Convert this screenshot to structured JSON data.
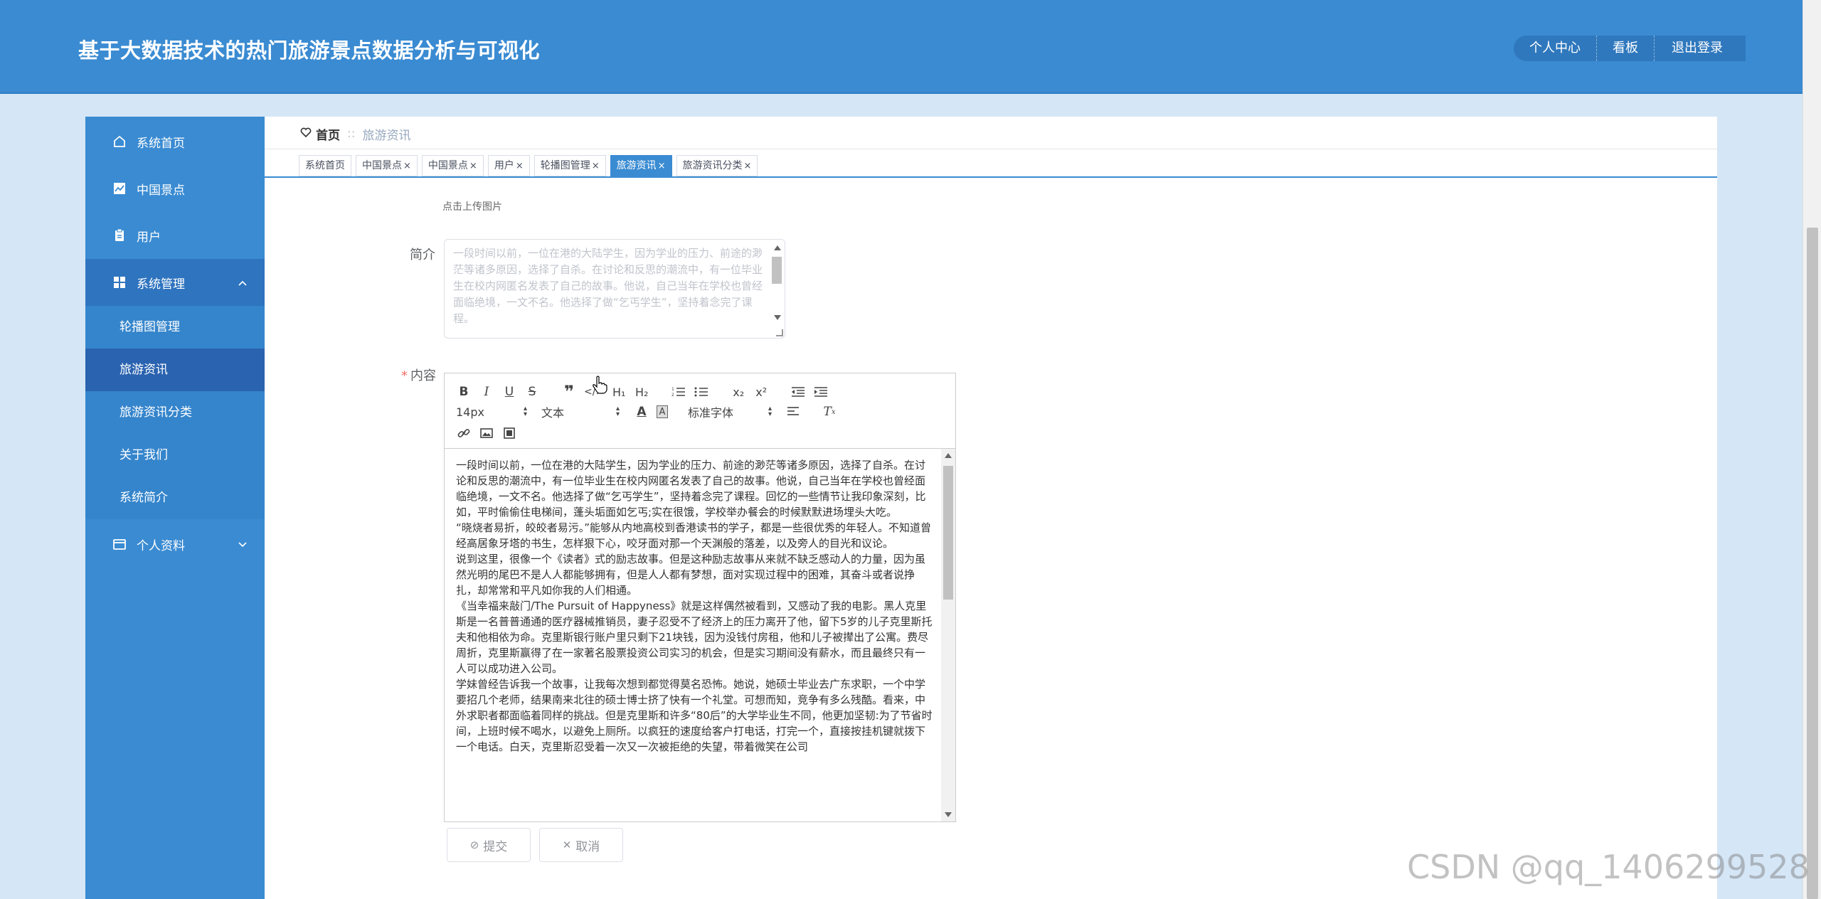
{
  "header": {
    "title": "基于大数据技术的热门旅游景点数据分析与可视化",
    "nav": [
      "个人中心",
      "看板",
      "退出登录"
    ]
  },
  "sidebar": {
    "items": [
      {
        "label": "系统首页",
        "icon": "home-icon"
      },
      {
        "label": "中国景点",
        "icon": "chart-icon"
      },
      {
        "label": "用户",
        "icon": "clipboard-icon"
      },
      {
        "label": "系统管理",
        "icon": "grid-icon"
      },
      {
        "label": "个人资料",
        "icon": "card-icon"
      }
    ],
    "sub_items": [
      "轮播图管理",
      "旅游资讯",
      "旅游资讯分类",
      "关于我们",
      "系统简介"
    ]
  },
  "breadcrumb": {
    "home": "首页",
    "separator": "::",
    "current": "旅游资讯"
  },
  "tabs": [
    {
      "label": "系统首页",
      "closable": false
    },
    {
      "label": "中国景点",
      "closable": true
    },
    {
      "label": "中国景点",
      "closable": true
    },
    {
      "label": "用户",
      "closable": true
    },
    {
      "label": "轮播图管理",
      "closable": true
    },
    {
      "label": "旅游资讯",
      "closable": true,
      "active": true
    },
    {
      "label": "旅游资讯分类",
      "closable": true
    }
  ],
  "form": {
    "upload_tip": "点击上传图片",
    "intro_label": "简介",
    "intro_text": "一段时间以前，一位在港的大陆学生，因为学业的压力、前途的渺茫等诸多原因，选择了自杀。在讨论和反思的潮流中，有一位毕业生在校内网匿名发表了自己的故事。他说，自己当年在学校也曾经面临绝境，一文不名。他选择了做“乞丐学生”，坚持着念完了课程。",
    "content_label": "内容",
    "toolbar": {
      "size": "14px",
      "header": "文本",
      "font": "标准字体"
    },
    "content_paragraphs": [
      "一段时间以前，一位在港的大陆学生，因为学业的压力、前途的渺茫等诸多原因，选择了自杀。在讨论和反思的潮流中，有一位毕业生在校内网匿名发表了自己的故事。他说，自己当年在学校也曾经面临绝境，一文不名。他选择了做“乞丐学生”，坚持着念完了课程。回忆的一些情节让我印象深刻，比如，平时偷偷住电梯间，蓬头垢面如乞丐;实在很饿，学校举办餐会的时候默默进场埋头大吃。",
      "“晓烧者易折，皎皎者易污。”能够从内地高校到香港读书的学子，都是一些很优秀的年轻人。不知道曾经高居象牙塔的书生，怎样狠下心，咬牙面对那一个天渊般的落差，以及旁人的目光和议论。",
      "说到这里，很像一个《读者》式的励志故事。但是这种励志故事从来就不缺乏感动人的力量，因为虽然光明的尾巴不是人人都能够拥有，但是人人都有梦想，面对实现过程中的困难，其奋斗或者说挣扎，却常常和平凡如你我的人们相通。",
      "《当幸福来敲门/The Pursuit of Happyness》就是这样偶然被看到，又感动了我的电影。黑人克里斯是一名普普通通的医疗器械推销员，妻子忍受不了经济上的压力离开了他，留下5岁的儿子克里斯托夫和他相依为命。克里斯银行账户里只剩下21块钱，因为没钱付房租，他和儿子被撵出了公寓。费尽周折，克里斯赢得了在一家著名股票投资公司实习的机会，但是实习期间没有薪水，而且最终只有一人可以成功进入公司。",
      "学妹曾经告诉我一个故事，让我每次想到都觉得莫名恐怖。她说，她硕士毕业去广东求职，一个中学要招几个老师，结果南来北往的硕士博士挤了快有一个礼堂。可想而知，竞争有多么残酷。看来，中外求职者都面临着同样的挑战。但是克里斯和许多“80后”的大学毕业生不同，他更加坚韧:为了节省时间，上班时候不喝水，以避免上厕所。以疯狂的速度给客户打电话，打完一个，直接按挂机键就拨下一个电话。白天，克里斯忍受着一次又一次被拒绝的失望，带着微笑在公司"
    ],
    "submit_label": "提交",
    "cancel_label": "取消"
  },
  "watermark": "CSDN @qq_1406299528",
  "colors": {
    "header_bg": "#3a8bd2",
    "sidebar_bg": "#3a8bd2",
    "sidebar_current": "#2a63b0",
    "page_bg": "#d5e6f6",
    "required": "#f56c6c"
  }
}
